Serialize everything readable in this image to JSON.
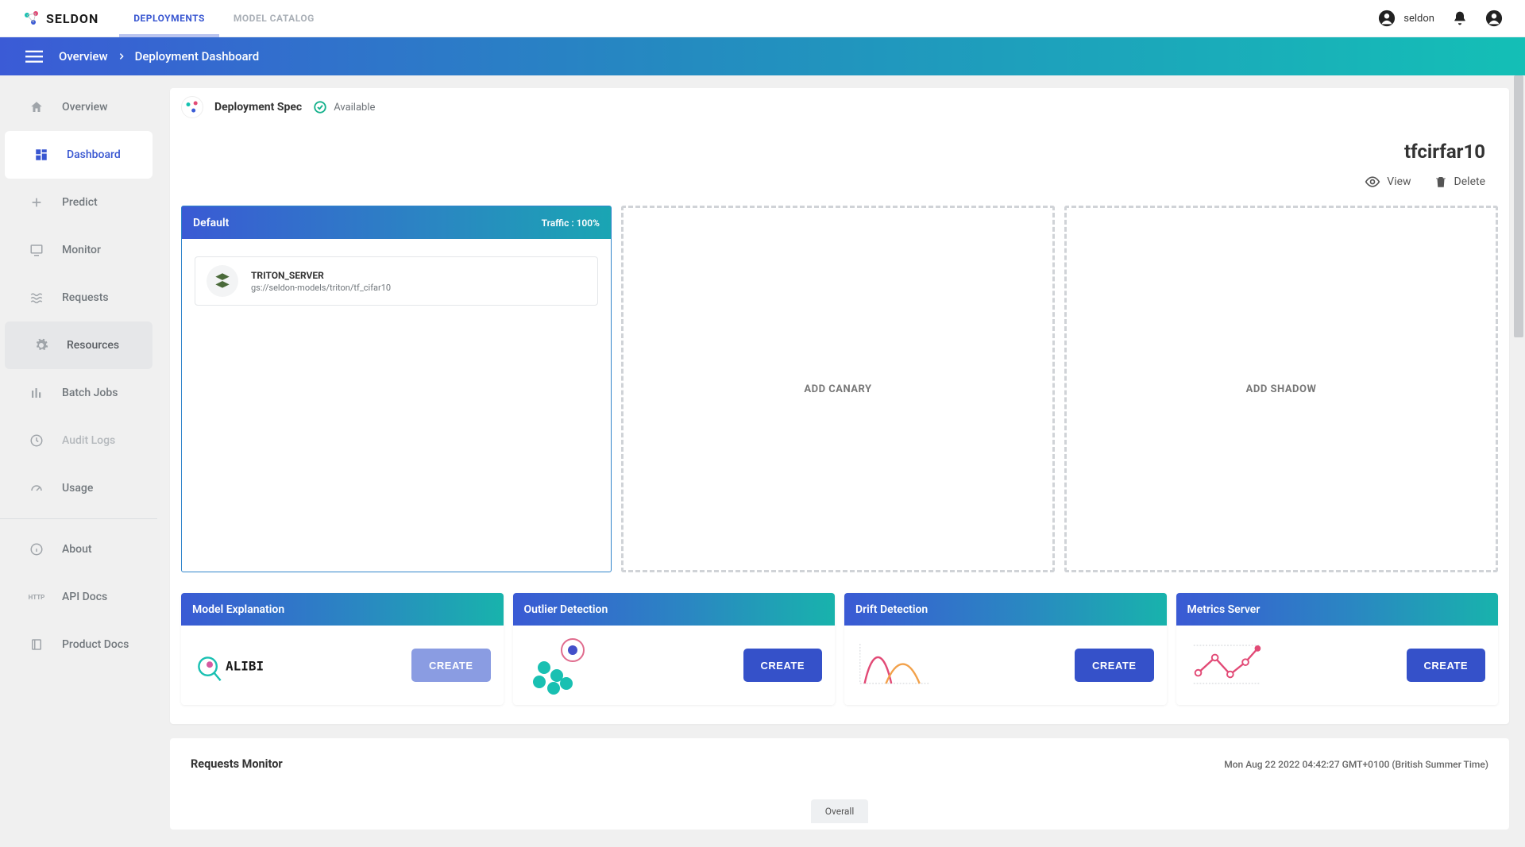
{
  "brand": "SELDON",
  "topnav": {
    "tabs": [
      {
        "label": "DEPLOYMENTS",
        "active": true
      },
      {
        "label": "MODEL CATALOG",
        "active": false
      }
    ],
    "user": "seldon"
  },
  "breadcrumb": {
    "items": [
      "Overview",
      "Deployment Dashboard"
    ]
  },
  "sidebar": {
    "items": [
      {
        "label": "Overview"
      },
      {
        "label": "Dashboard"
      },
      {
        "label": "Predict"
      },
      {
        "label": "Monitor"
      },
      {
        "label": "Requests"
      },
      {
        "label": "Resources"
      },
      {
        "label": "Batch Jobs"
      },
      {
        "label": "Audit Logs"
      },
      {
        "label": "Usage"
      },
      {
        "label": "About"
      },
      {
        "label": "API Docs"
      },
      {
        "label": "Product Docs"
      }
    ]
  },
  "spec": {
    "title": "Deployment Spec",
    "status": "Available"
  },
  "deployment": {
    "name": "tfcirfar10",
    "actions": {
      "view": "View",
      "delete": "Delete"
    }
  },
  "predictors": {
    "default": {
      "title": "Default",
      "traffic": "Traffic : 100%",
      "model_name": "TRITON_SERVER",
      "model_path": "gs://seldon-models/triton/tf_cifar10"
    },
    "canary_label": "ADD CANARY",
    "shadow_label": "ADD SHADOW"
  },
  "features": {
    "model_explanation": {
      "title": "Model Explanation",
      "button": "CREATE",
      "icon_text": "ALIBI"
    },
    "outlier_detection": {
      "title": "Outlier Detection",
      "button": "CREATE"
    },
    "drift_detection": {
      "title": "Drift Detection",
      "button": "CREATE"
    },
    "metrics_server": {
      "title": "Metrics Server",
      "button": "CREATE"
    }
  },
  "requests_monitor": {
    "title": "Requests Monitor",
    "date": "Mon Aug 22 2022 04:42:27 GMT+0100 (British Summer Time)",
    "tab": "Overall"
  }
}
